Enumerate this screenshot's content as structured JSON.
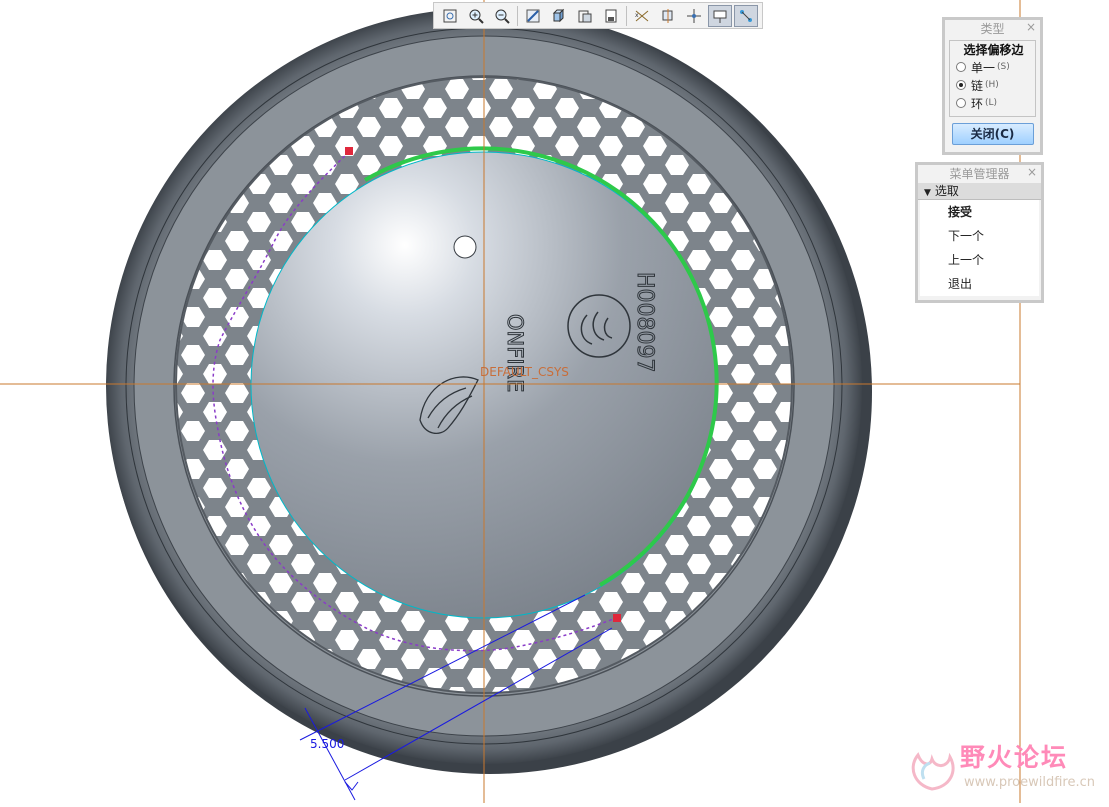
{
  "viewport": {
    "csys_label": "DEFAULT_CSYS",
    "dimension_value": "5.500",
    "model_text_brand": "ONFIRE",
    "model_text_part": "H008097"
  },
  "toolbar": {
    "buttons": [
      {
        "name": "refit-icon"
      },
      {
        "name": "zoom-in-icon"
      },
      {
        "name": "zoom-out-icon"
      },
      {
        "name": "repaint-icon"
      },
      {
        "name": "display-style-icon"
      },
      {
        "name": "saved-views-icon"
      },
      {
        "name": "layers-icon"
      },
      {
        "name": "datum-planes-icon"
      },
      {
        "name": "datum-axes-icon"
      },
      {
        "name": "datum-points-icon"
      },
      {
        "name": "csys-display-icon"
      },
      {
        "name": "annotation-display-icon"
      }
    ]
  },
  "type_panel": {
    "title": "类型",
    "close": "×",
    "group_label": "选择偏移边",
    "options": [
      {
        "label": "单一",
        "hotkey": "(S)",
        "selected": false
      },
      {
        "label": "链",
        "hotkey": "(H)",
        "selected": true
      },
      {
        "label": "环",
        "hotkey": "(L)",
        "selected": false
      }
    ],
    "close_button": "关闭(C)"
  },
  "menu_manager": {
    "title": "菜单管理器",
    "close": "×",
    "section": "选取",
    "items": [
      "接受",
      "下一个",
      "上一个",
      "退出"
    ]
  },
  "watermark": {
    "title": "野火论坛",
    "url": "www.proewildfire.cn"
  },
  "colors": {
    "selection_green": "#2ec94a",
    "datum_orange": "#c8782e",
    "dimension_blue": "#1a1ae0",
    "model_gray": "#8a9097"
  }
}
